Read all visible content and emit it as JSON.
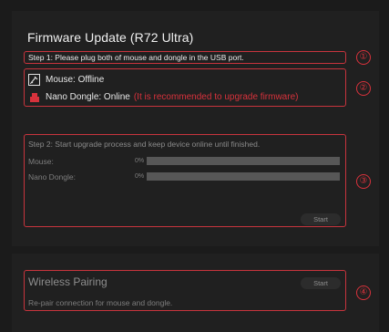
{
  "title": "Firmware Update (R72 Ultra)",
  "step1": {
    "text": "Step 1: Please plug both of mouse and dongle in the USB port.",
    "marker": "①"
  },
  "devices": {
    "marker": "②",
    "mouse": {
      "label": "Mouse: Offline",
      "icon": "mouse-icon"
    },
    "dongle": {
      "label": "Nano Dongle: Online",
      "warning": "(It is recommended to upgrade firmware)",
      "icon": "dongle-icon"
    }
  },
  "step2": {
    "text": "Step 2: Start upgrade process and keep device online until finished.",
    "marker": "③",
    "mouse": {
      "label": "Mouse:",
      "percent": "0%",
      "progress": 0
    },
    "dongle": {
      "label": "Nano Dongle:",
      "percent": "0%",
      "progress": 0
    },
    "start_label": "Start"
  },
  "wireless": {
    "title": "Wireless Pairing",
    "description": "Re-pair connection for mouse and dongle.",
    "start_label": "Start",
    "marker": "④"
  },
  "colors": {
    "accent": "#d8323c",
    "background": "#1b1b1b",
    "panel": "#202020"
  }
}
